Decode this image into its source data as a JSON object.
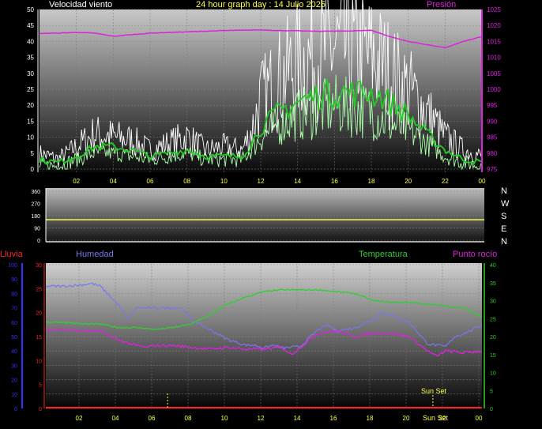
{
  "header": {
    "title": "24 hour graph day : 14 Julio 2025",
    "wind_label": "Velocidad viento",
    "pressure_label": "Presión"
  },
  "direction_labels": [
    "N",
    "W",
    "S",
    "E",
    "N"
  ],
  "lower_labels": {
    "rain": "Lluvia",
    "humidity": "Humedad",
    "temperature": "Temperatura",
    "dewpoint": "Punto rocío"
  },
  "sunset_label": "Sun Set",
  "colors": {
    "wind_gust": "#ffffff",
    "wind_avg": "#aaffaa",
    "wind_mean": "#22cc22",
    "pressure": "#dd22dd",
    "direction": "#ffff44",
    "humidity": "#7777ee",
    "temperature": "#33cc33",
    "dewpoint": "#dd22dd",
    "rain": "#ff2222",
    "sunset": "#ffff44",
    "axis_wind": "#ffffff",
    "axis_pressure": "#dd22dd",
    "axis_rain": "#3333ff",
    "axis_rain_mm": "#ff2222",
    "axis_temp": "#33cc33",
    "hour_ticks": "#ffff44"
  },
  "chart_data": [
    {
      "type": "line",
      "title": "24 hour graph day : 14 Julio 2025",
      "x_ticks": [
        "02",
        "04",
        "06",
        "08",
        "10",
        "12",
        "14",
        "16",
        "18",
        "20",
        "22",
        "00"
      ],
      "y_left_label": "Velocidad viento",
      "y_left_ticks": [
        0,
        5,
        10,
        15,
        20,
        25,
        30,
        35,
        40,
        45,
        50
      ],
      "ylim_left": [
        0,
        50
      ],
      "y_right_label": "Presión",
      "y_right_ticks": [
        975,
        980,
        985,
        990,
        995,
        1000,
        1005,
        1010,
        1015,
        1020,
        1025
      ],
      "ylim_right": [
        975,
        1025
      ],
      "series": [
        {
          "name": "gust",
          "axis": "left",
          "x": [
            0,
            1,
            2,
            3,
            4,
            5,
            6,
            7,
            8,
            9,
            10,
            11,
            11.5,
            12,
            13,
            14,
            15,
            16,
            17,
            18,
            18.5,
            19,
            20,
            21,
            22,
            23,
            24
          ],
          "values": [
            5,
            3,
            7,
            11,
            10,
            9,
            6,
            8,
            10,
            6,
            7,
            6,
            12,
            22,
            28,
            33,
            36,
            38,
            37,
            35,
            33,
            30,
            25,
            18,
            10,
            6,
            4
          ]
        },
        {
          "name": "average",
          "axis": "left",
          "x": [
            0,
            1,
            2,
            3,
            4,
            5,
            6,
            7,
            8,
            9,
            10,
            11,
            11.5,
            12,
            13,
            14,
            15,
            16,
            17,
            18,
            18.5,
            19,
            20,
            21,
            22,
            23,
            24
          ],
          "values": [
            1,
            1,
            3,
            5,
            5,
            4,
            3,
            4,
            5,
            3,
            3,
            3,
            6,
            10,
            14,
            17,
            18,
            20,
            19,
            18,
            16,
            14,
            12,
            8,
            4,
            2,
            1
          ]
        },
        {
          "name": "mean",
          "axis": "left",
          "x": [
            0,
            1,
            2,
            3,
            4,
            5,
            6,
            7,
            8,
            9,
            10,
            11,
            11.5,
            12,
            13,
            14,
            15,
            16,
            17,
            18,
            18.5,
            19,
            20,
            21,
            22,
            23,
            24
          ],
          "values": [
            3,
            2,
            4,
            7,
            7,
            6,
            4,
            5,
            6,
            4,
            4,
            4,
            8,
            13,
            18,
            21,
            23,
            24,
            24,
            24,
            23,
            21,
            17,
            11,
            6,
            3,
            2
          ]
        },
        {
          "name": "pressure",
          "axis": "right",
          "x": [
            0,
            1,
            2,
            3,
            4,
            5,
            6,
            7,
            8,
            9,
            10,
            11,
            12,
            13,
            14,
            15,
            16,
            17,
            18,
            19,
            20,
            21,
            22,
            23,
            24
          ],
          "values": [
            1017.5,
            1017.6,
            1017.8,
            1017.6,
            1016.6,
            1017.1,
            1017.6,
            1017.8,
            1018.0,
            1018.2,
            1018.4,
            1018.5,
            1018.6,
            1018.4,
            1018.3,
            1018.2,
            1018.2,
            1018.3,
            1018.5,
            1016.5,
            1015.0,
            1014.0,
            1013.0,
            1015.0,
            1016.5
          ]
        }
      ]
    },
    {
      "type": "line",
      "x_ticks": [
        "02",
        "04",
        "06",
        "08",
        "10",
        "12",
        "14",
        "16",
        "18",
        "20",
        "22",
        "00"
      ],
      "y_left_ticks": [
        0,
        90,
        180,
        270,
        360
      ],
      "ylim_left": [
        0,
        360
      ],
      "y_right_ticks": [
        "N",
        "W",
        "S",
        "E",
        "N"
      ],
      "series": [
        {
          "name": "direction",
          "x": [
            0,
            24
          ],
          "values": [
            150,
            150
          ]
        }
      ]
    },
    {
      "type": "line",
      "x_ticks": [
        "02",
        "04",
        "06",
        "08",
        "10",
        "12",
        "14",
        "16",
        "18",
        "20",
        "22",
        "00"
      ],
      "y_humidity_ticks": [
        0,
        10,
        20,
        30,
        40,
        50,
        60,
        70,
        80,
        90,
        100
      ],
      "ylim_humidity": [
        0,
        100
      ],
      "y_rain_ticks": [
        0,
        5,
        10,
        15,
        20,
        25,
        30
      ],
      "ylim_rain": [
        0,
        30
      ],
      "y_temp_ticks": [
        0,
        5,
        10,
        15,
        20,
        25,
        30,
        35,
        40
      ],
      "ylim_temp": [
        0,
        40
      ],
      "sunset_x": [
        21.0,
        24.0
      ],
      "dawn_marker_x": 6.7,
      "series": [
        {
          "name": "humidity",
          "axis": "humidity",
          "x": [
            0,
            1,
            2,
            2.5,
            3,
            4,
            4.5,
            5,
            6,
            7,
            7.5,
            8,
            9,
            10,
            11,
            11.5,
            12,
            12.5,
            13,
            14,
            15,
            15.5,
            16,
            17,
            18,
            18.5,
            19,
            20,
            21,
            22,
            22.5,
            23,
            24
          ],
          "values": [
            85,
            85,
            86,
            87,
            85,
            72,
            62,
            70,
            70,
            70,
            70,
            62,
            55,
            48,
            44,
            44,
            42,
            44,
            42,
            43,
            55,
            58,
            54,
            56,
            62,
            67,
            65,
            60,
            45,
            43,
            50,
            52,
            58
          ]
        },
        {
          "name": "temperature",
          "axis": "temp",
          "x": [
            0,
            1,
            2,
            3,
            4,
            5,
            6,
            7,
            8,
            9,
            10,
            11,
            12,
            13,
            14,
            15,
            16,
            17,
            18,
            19,
            20,
            21,
            22,
            23,
            24
          ],
          "values": [
            24,
            24,
            23.5,
            23.5,
            22.5,
            22.5,
            22,
            22.5,
            23.5,
            26,
            29,
            31,
            32.5,
            33,
            33,
            33,
            32.5,
            32,
            30,
            29.5,
            29.5,
            29,
            28.5,
            28,
            25.5
          ]
        },
        {
          "name": "dewpoint",
          "axis": "temp",
          "x": [
            0,
            1,
            2,
            3,
            4,
            5,
            5.5,
            6,
            7,
            8,
            9,
            10,
            11,
            12,
            13,
            13.5,
            14,
            15,
            16,
            17,
            18,
            19,
            20,
            21,
            21.5,
            22,
            23,
            24
          ],
          "values": [
            22,
            22,
            21.5,
            21.5,
            19,
            17.5,
            17,
            17.5,
            17.5,
            17,
            16.5,
            17,
            16.5,
            16.5,
            17,
            15,
            17,
            21,
            21.5,
            20,
            21,
            21,
            20,
            16,
            14.5,
            16,
            15.5,
            16
          ]
        },
        {
          "name": "rain",
          "axis": "rain",
          "x": [
            0,
            24
          ],
          "values": [
            0,
            0
          ]
        }
      ]
    }
  ]
}
